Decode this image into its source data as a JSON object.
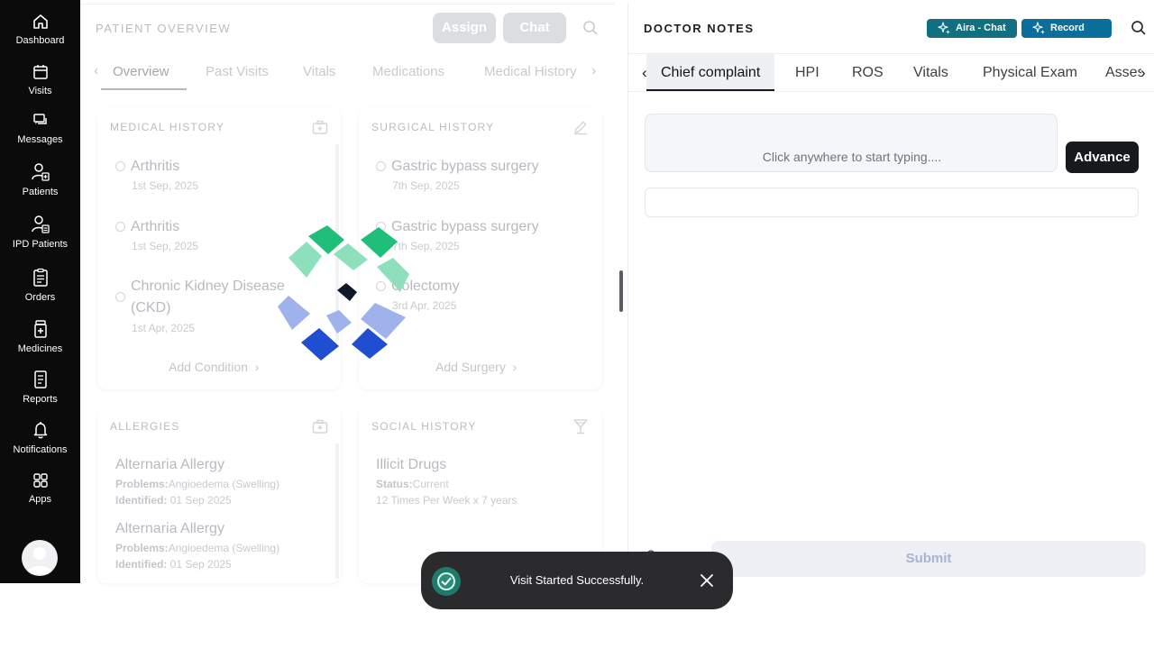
{
  "sidebar": {
    "items": [
      {
        "label": "Dashboard",
        "icon": "home-icon"
      },
      {
        "label": "Visits",
        "icon": "calendar-icon"
      },
      {
        "label": "Messages",
        "icon": "chat-icon"
      },
      {
        "label": "Patients",
        "icon": "patient-icon"
      },
      {
        "label": "IPD Patients",
        "icon": "ipd-patient-icon"
      },
      {
        "label": "Orders",
        "icon": "orders-icon"
      },
      {
        "label": "Medicines",
        "icon": "medicine-icon"
      },
      {
        "label": "Reports",
        "icon": "report-icon"
      },
      {
        "label": "Notifications",
        "icon": "bell-icon"
      },
      {
        "label": "Apps",
        "icon": "apps-icon"
      }
    ]
  },
  "patient_overview": {
    "title": "PATIENT OVERVIEW",
    "assign_label": "Assign",
    "chat_label": "Chat",
    "tabs": [
      "Overview",
      "Past Visits",
      "Vitals",
      "Medications",
      "Medical History"
    ],
    "active_tab": "Overview",
    "medical_history": {
      "title": "MEDICAL HISTORY",
      "items": [
        {
          "name": "Arthritis",
          "date": "1st Sep, 2025"
        },
        {
          "name": "Arthritis",
          "date": "1st Sep, 2025"
        },
        {
          "name_line1": "Chronic Kidney Disease",
          "name_line2": "(CKD)",
          "date": "1st Apr, 2025"
        }
      ],
      "add_label": "Add Condition"
    },
    "surgical_history": {
      "title": "SURGICAL HISTORY",
      "items": [
        {
          "name": "Gastric bypass surgery",
          "date": "7th Sep, 2025"
        },
        {
          "name": "Gastric bypass surgery",
          "date": "7th Sep, 2025"
        },
        {
          "name": "Colectomy",
          "date": "3rd Apr, 2025"
        }
      ],
      "add_label": "Add Surgery"
    },
    "allergies": {
      "title": "ALLERGIES",
      "problems_label": "Problems:",
      "identified_label": "Identified:",
      "items": [
        {
          "name": "Alternaria Allergy",
          "problems": "Angioedema (Swelling)",
          "identified": "01 Sep 2025"
        },
        {
          "name": "Alternaria Allergy",
          "problems": "Angioedema (Swelling)",
          "identified": "01 Sep 2025"
        }
      ]
    },
    "social_history": {
      "title": "SOCIAL HISTORY",
      "items": [
        {
          "name": "Illicit Drugs",
          "status_label": "Status:",
          "status": "Current",
          "frequency": "12 Times Per Week x 7 years"
        }
      ]
    }
  },
  "doctor_notes": {
    "title": "DOCTOR NOTES",
    "aira_chat_label": "Aira - Chat",
    "record_label": "Record",
    "tabs": [
      "Chief complaint",
      "HPI",
      "ROS",
      "Vitals",
      "Physical Exam",
      "Assess"
    ],
    "active_tab": "Chief complaint",
    "editor_placeholder": "Click anywhere to start typing....",
    "advance_label": "Advance",
    "submit_label": "Submit"
  },
  "toast": {
    "message": "Visit Started Successfully."
  },
  "colors": {
    "sidebar_bg": "#0b0b0c",
    "aira_pill": "#11707f",
    "record_pill": "#0c6e9a",
    "toast_bg": "#2b2b2d",
    "loader_green": "#1fbf7a",
    "loader_blue": "#1f4fd0"
  }
}
